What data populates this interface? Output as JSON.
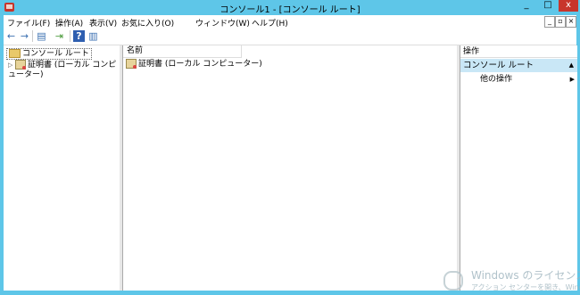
{
  "window": {
    "title": "コンソール1 - [コンソール ルート]",
    "min_label": "_",
    "max_label": "□",
    "close_label": "x"
  },
  "menu": {
    "items": [
      "ファイル(F)",
      "操作(A)",
      "表示(V)",
      "お気に入り(O)",
      "ウィンドウ(W)",
      "ヘルプ(H)"
    ],
    "mdi_min": "_",
    "mdi_restore": "▫",
    "mdi_close": "×"
  },
  "toolbar": {
    "back": "←",
    "forward": "→",
    "show_tree": "▤",
    "export": "⇥",
    "help": "?",
    "show_actions": "▥"
  },
  "tree": {
    "root_label": "コンソール ルート",
    "child_label": "証明書 (ローカル コンピューター)",
    "expander": "▷"
  },
  "list": {
    "column_header": "名前",
    "rows": [
      "証明書 (ローカル コンピューター)"
    ]
  },
  "actions": {
    "header": "操作",
    "section_title": "コンソール ルート",
    "collapse": "▲",
    "item_label": "他の操作",
    "item_arrow": "▶"
  },
  "watermark": {
    "line1": "Windows のライセンス",
    "line2": "アクション センターを開き、Wind"
  },
  "colors": {
    "frame": "#5ec6e8",
    "close": "#c8352b",
    "action_section": "#c9e7f6"
  }
}
